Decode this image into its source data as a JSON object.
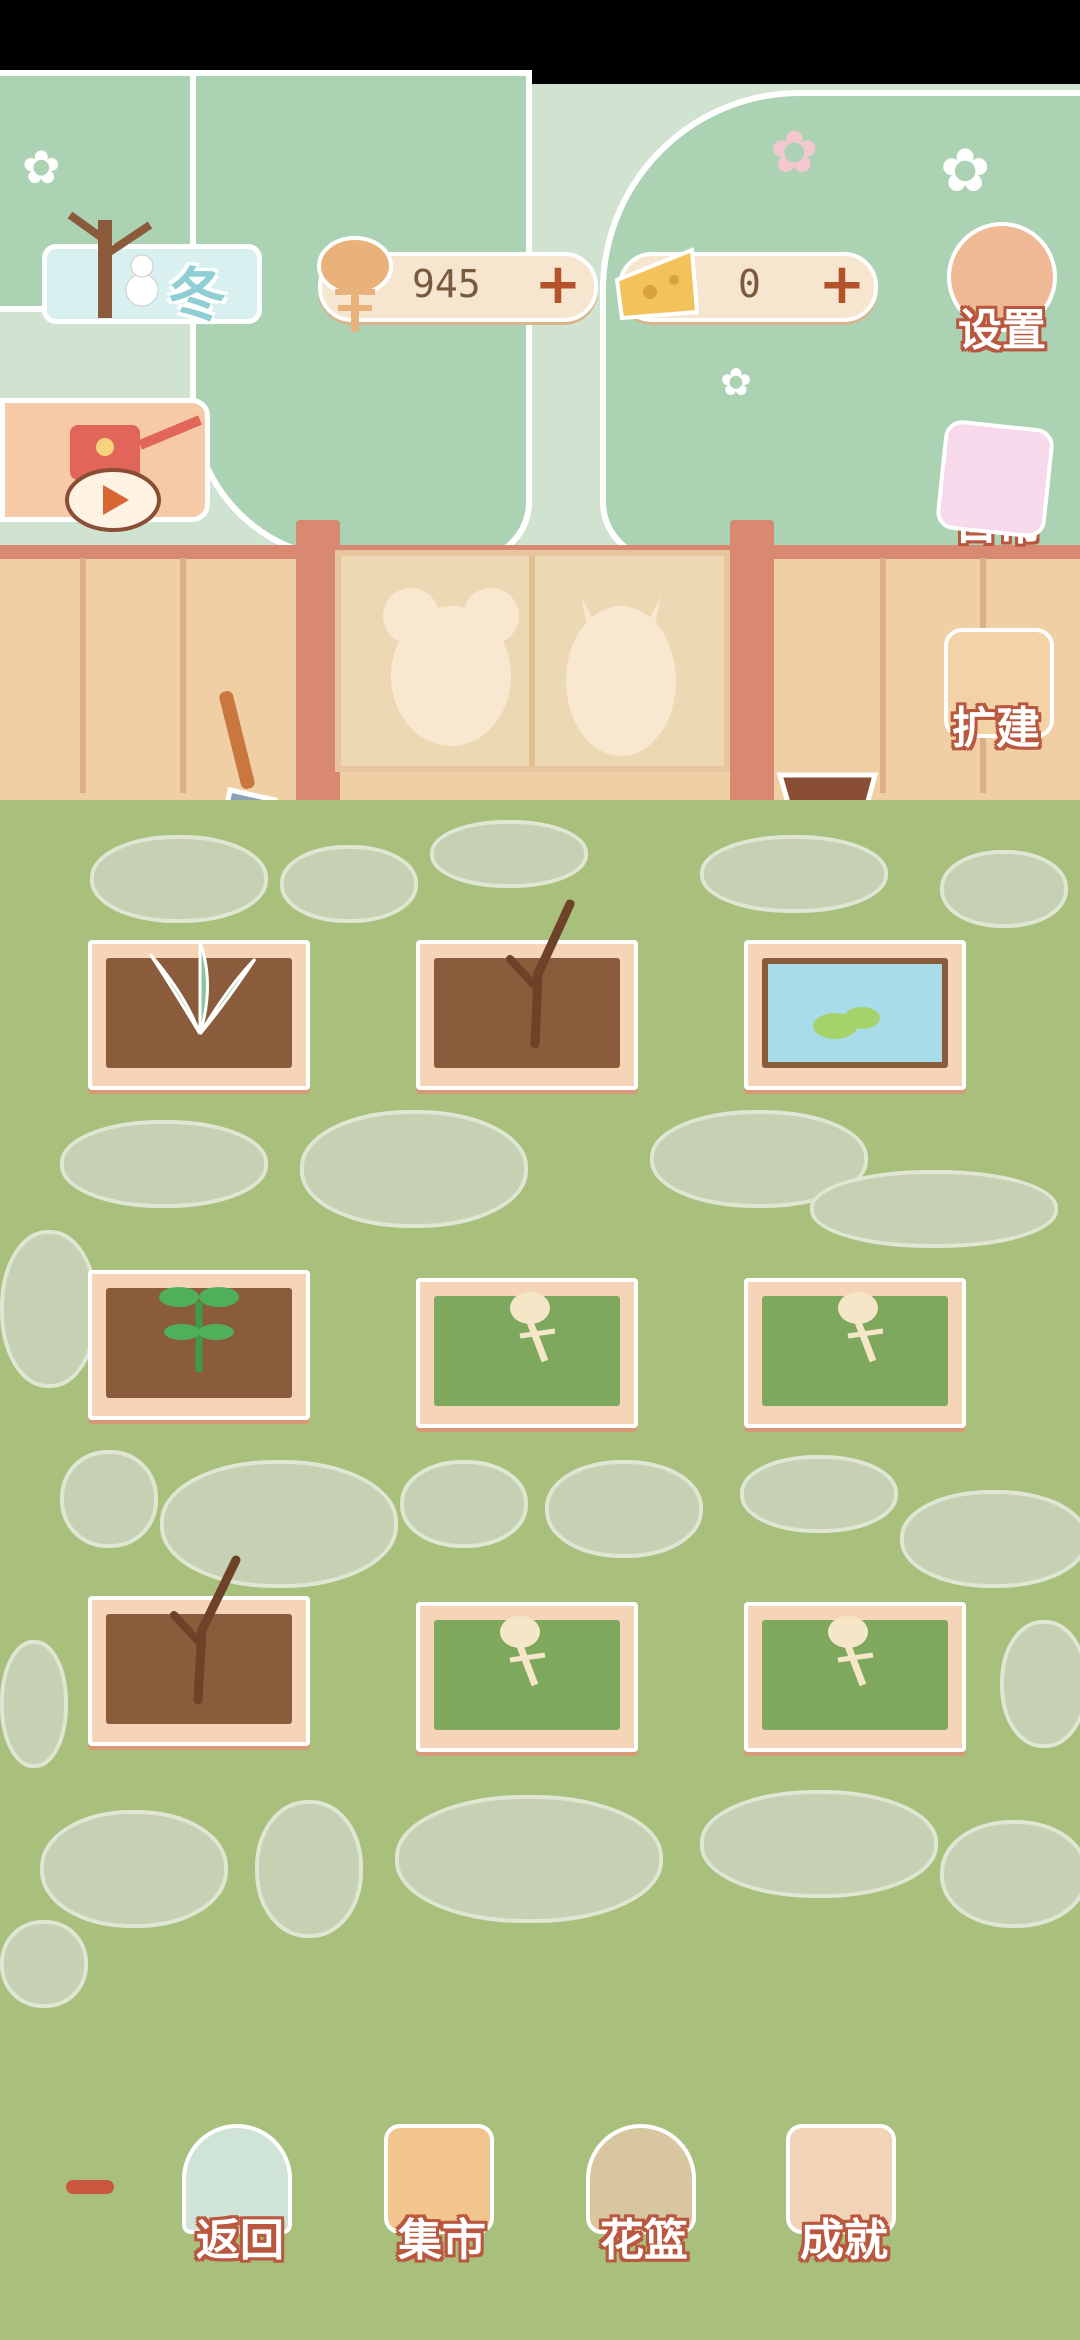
{
  "season": {
    "label": "冬"
  },
  "resources": {
    "fish": {
      "value": "945",
      "plus": "+"
    },
    "cheese": {
      "value": "0",
      "plus": "+"
    }
  },
  "side_menu": {
    "settings": "设置",
    "daily": "日常",
    "expand": "扩建"
  },
  "bottom_nav": {
    "minus": "−",
    "back": "返回",
    "market": "集市",
    "basket": "花篮",
    "achievements": "成就"
  },
  "plots": [
    {
      "state": "leafy-plant"
    },
    {
      "state": "bare-branch"
    },
    {
      "state": "water-lily"
    },
    {
      "state": "sprout"
    },
    {
      "state": "overgrown-fishbone"
    },
    {
      "state": "overgrown-fishbone"
    },
    {
      "state": "bare-branch"
    },
    {
      "state": "overgrown-fishbone"
    },
    {
      "state": "overgrown-fishbone"
    }
  ],
  "colors": {
    "accent": "#b9573f",
    "lawn": "#a9c07d",
    "sky": "#cfe3d0",
    "plus": "#b4522c"
  }
}
